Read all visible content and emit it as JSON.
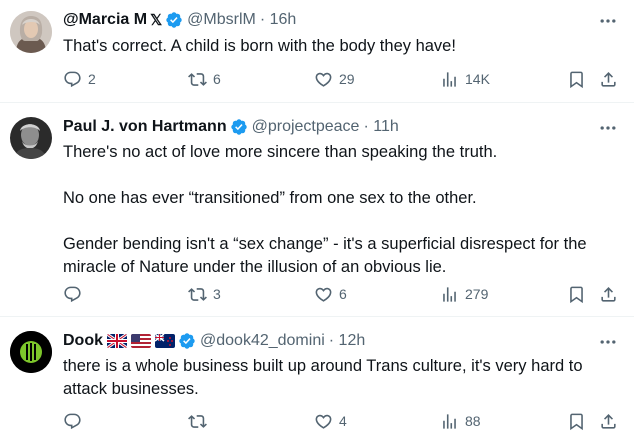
{
  "tweets": [
    {
      "name": "@Marcia M",
      "x_badge": "𝕏",
      "handle": "@MbsrlM",
      "time": "· 16h",
      "text": [
        "That's correct. A child is born with the body they have!"
      ],
      "replies": "2",
      "reposts": "6",
      "likes": "29",
      "views": "14K",
      "avatar_icon": "woman-portrait"
    },
    {
      "name": "Paul J. von Hartmann",
      "handle": "@projectpeace",
      "time": "· 11h",
      "text": [
        "There's no act of love more sincere than speaking the truth.",
        "No one has ever “transitioned” from one sex to the other.",
        "Gender bending isn't a “sex change” - it's a superficial disrespect for the miracle of Nature under the illusion of an obvious lie."
      ],
      "replies": "",
      "reposts": "3",
      "likes": "6",
      "views": "279",
      "avatar_icon": "man-portrait-bw"
    },
    {
      "name": "Dook",
      "flags": [
        "uk-flag",
        "us-flag",
        "nz-flag"
      ],
      "handle": "@dook42_domini",
      "time": "· 12h",
      "text": [
        "there is a whole business built up around Trans culture, it's very hard to attack businesses."
      ],
      "replies": "",
      "reposts": "",
      "likes": "4",
      "views": "88",
      "avatar_icon": "green-circle-logo"
    }
  ],
  "colors": {
    "verified": "#1d9bf0",
    "secondary_text": "#536471",
    "primary_text": "#0f1419",
    "divider": "#eff3f4"
  }
}
